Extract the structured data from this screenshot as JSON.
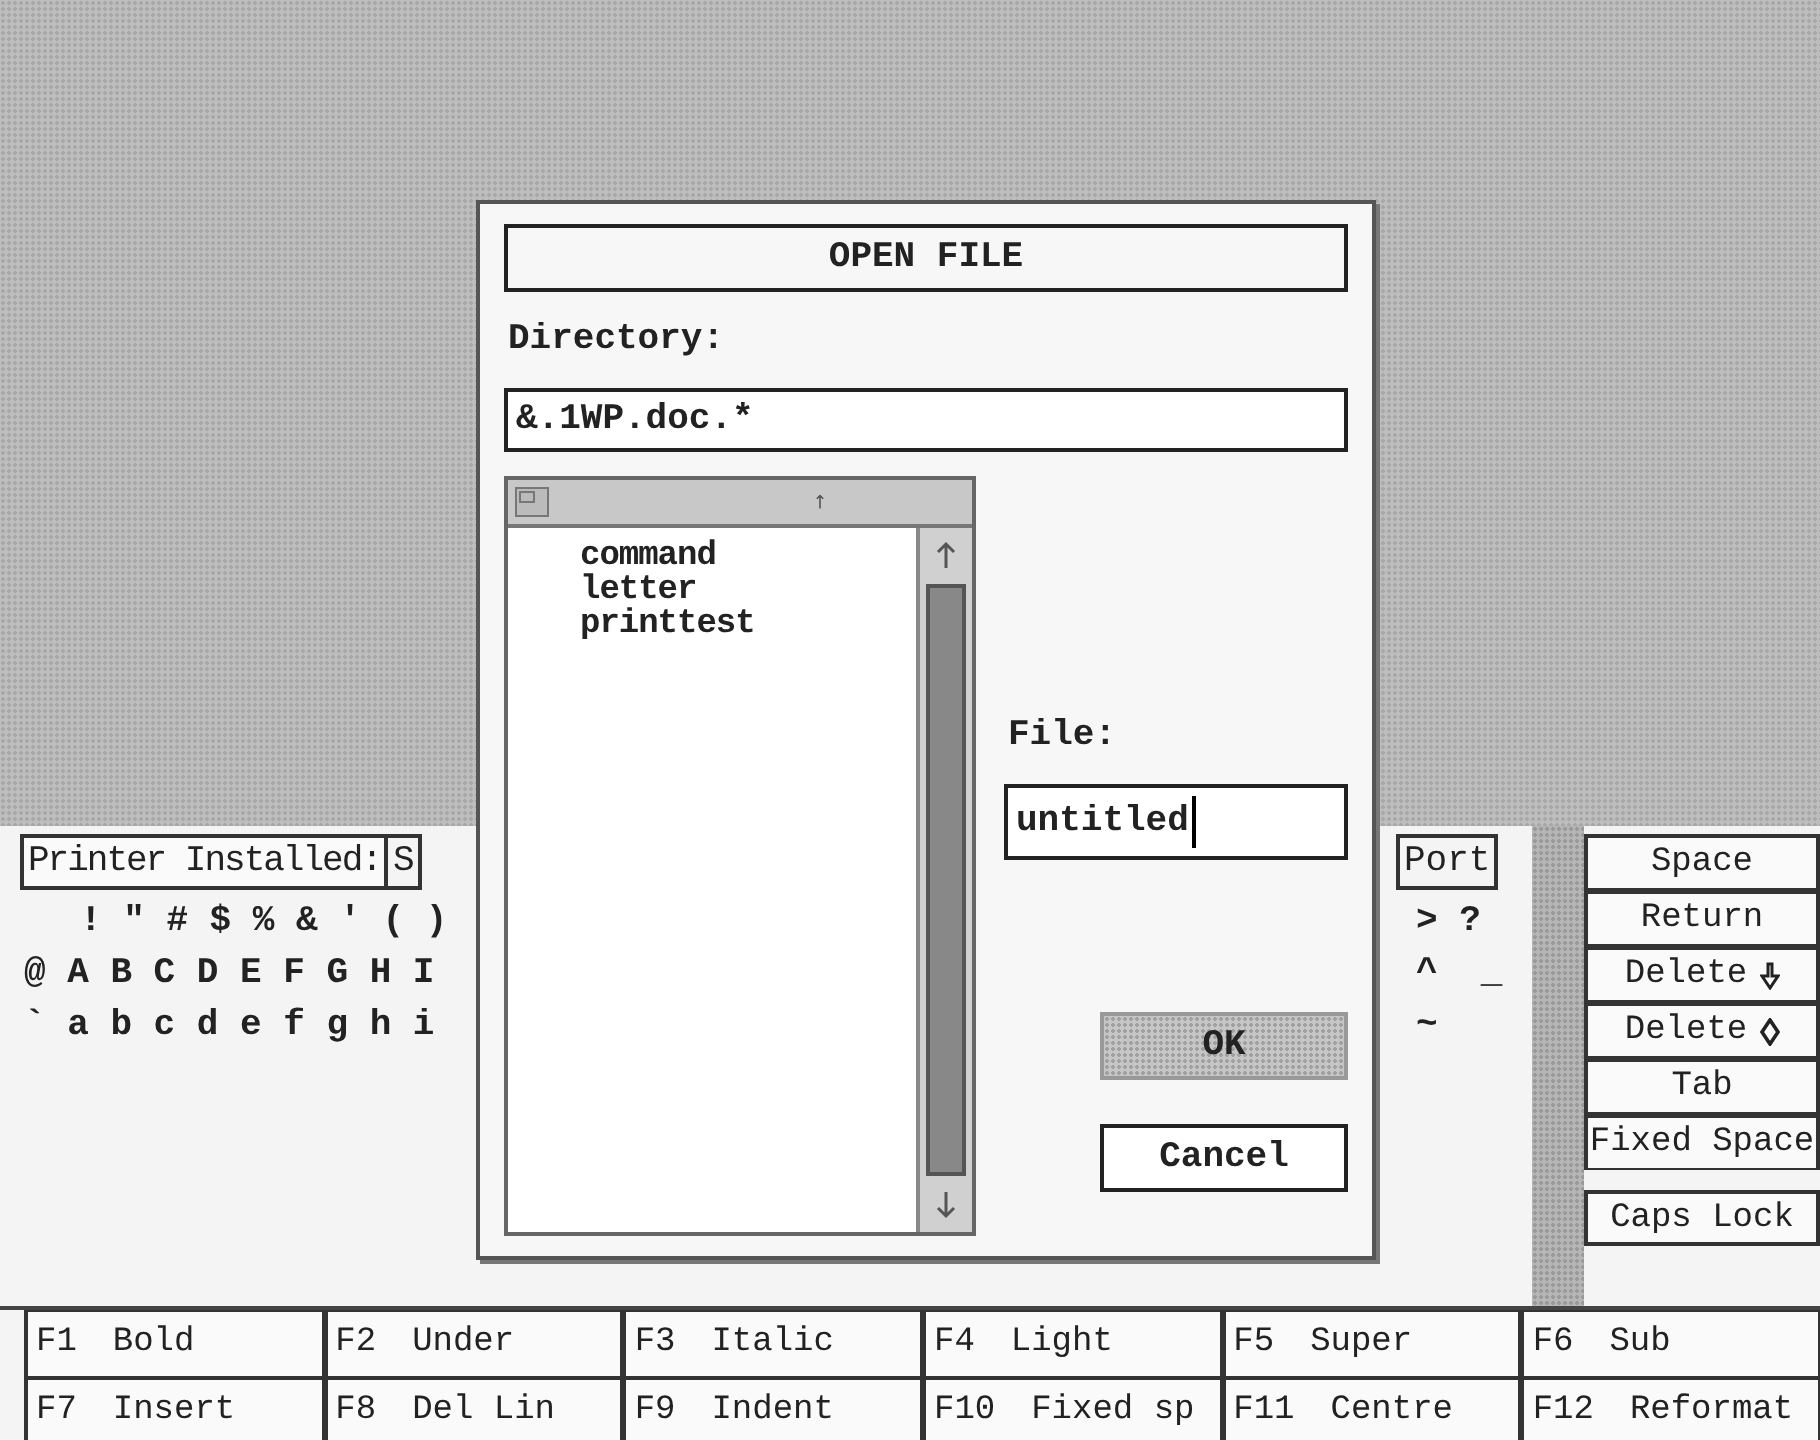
{
  "background_panel": {
    "printer_label": "Printer Installed:",
    "printer_value": "S",
    "port_label": "Port",
    "char_rows_left": [
      "! \" # $ % & ' ( )",
      "@ A B C D E F G H I",
      "` a b c d e f g h i"
    ],
    "char_rows_right": [
      "> ?",
      "^  _",
      "~"
    ]
  },
  "key_buttons": [
    {
      "label": "Space"
    },
    {
      "label": "Return"
    },
    {
      "label": "Delete",
      "kind": "delete-down"
    },
    {
      "label": "Delete",
      "kind": "delete-diamond"
    },
    {
      "label": "Tab"
    },
    {
      "label": "Fixed Space"
    },
    {
      "label": "Caps Lock"
    }
  ],
  "function_keys": [
    {
      "key": "F1",
      "label": "Bold"
    },
    {
      "key": "F2",
      "label": "Under"
    },
    {
      "key": "F3",
      "label": "Italic"
    },
    {
      "key": "F4",
      "label": "Light"
    },
    {
      "key": "F5",
      "label": "Super"
    },
    {
      "key": "F6",
      "label": "Sub"
    },
    {
      "key": "F7",
      "label": "Insert"
    },
    {
      "key": "F8",
      "label": "Del Lin"
    },
    {
      "key": "F9",
      "label": "Indent"
    },
    {
      "key": "F10",
      "label": "Fixed sp"
    },
    {
      "key": "F11",
      "label": "Centre"
    },
    {
      "key": "F12",
      "label": "Reformat"
    }
  ],
  "dialog": {
    "title": "OPEN FILE",
    "directory_label": "Directory:",
    "directory_value": "&.1WP.doc.*",
    "files": [
      {
        "name": "command"
      },
      {
        "name": "letter"
      },
      {
        "name": "printtest"
      }
    ],
    "file_label": "File:",
    "file_value": "untitled",
    "buttons": [
      {
        "label": "OK",
        "selected": true
      },
      {
        "label": "Cancel",
        "selected": false
      }
    ]
  }
}
